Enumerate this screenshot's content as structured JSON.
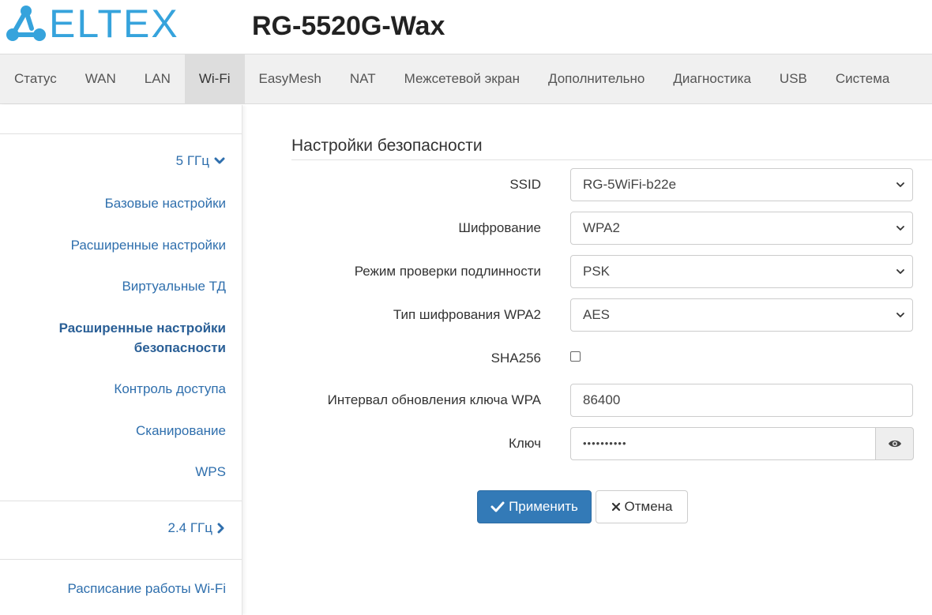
{
  "header": {
    "logo_text": "ELTEX",
    "model": "RG-5520G-Wax"
  },
  "nav": {
    "items": [
      {
        "label": "Статус",
        "active": false
      },
      {
        "label": "WAN",
        "active": false
      },
      {
        "label": "LAN",
        "active": false
      },
      {
        "label": "Wi-Fi",
        "active": true
      },
      {
        "label": "EasyMesh",
        "active": false
      },
      {
        "label": "NAT",
        "active": false
      },
      {
        "label": "Межсетевой экран",
        "active": false
      },
      {
        "label": "Дополнительно",
        "active": false
      },
      {
        "label": "Диагностика",
        "active": false
      },
      {
        "label": "USB",
        "active": false
      },
      {
        "label": "Система",
        "active": false
      }
    ]
  },
  "sidebar": {
    "group_5ghz": {
      "label": "5 ГГц",
      "icon": "chevron-down-icon",
      "expanded": true
    },
    "links": [
      {
        "label": "Базовые настройки",
        "active": false
      },
      {
        "label": "Расширенные настройки",
        "active": false
      },
      {
        "label": "Виртуальные ТД",
        "active": false
      },
      {
        "label_line1": "Расширенные настройки",
        "label_line2": "безопасности",
        "active": true
      },
      {
        "label": "Контроль доступа",
        "active": false
      },
      {
        "label": "Сканирование",
        "active": false
      },
      {
        "label": "WPS",
        "active": false
      }
    ],
    "group_24ghz": {
      "label": "2.4 ГГц",
      "icon": "chevron-right-icon",
      "expanded": false
    },
    "schedule_link": {
      "label": "Расписание работы Wi-Fi"
    }
  },
  "form": {
    "title": "Настройки безопасности",
    "ssid": {
      "label": "SSID",
      "value": "RG-5WiFi-b22e"
    },
    "encryption": {
      "label": "Шифрование",
      "value": "WPA2"
    },
    "auth_mode": {
      "label": "Режим проверки подлинности",
      "value": "PSK"
    },
    "wpa2_cipher": {
      "label": "Тип шифрования WPA2",
      "value": "AES"
    },
    "sha256": {
      "label": "SHA256",
      "checked": false
    },
    "rekey_interval": {
      "label": "Интервал обновления ключа WPA",
      "value": "86400"
    },
    "key": {
      "label": "Ключ",
      "value": "••••••••••",
      "toggle_icon": "eye-icon"
    },
    "apply_label": "Применить",
    "cancel_label": "Отмена"
  },
  "colors": {
    "brand": "#36a3dc",
    "link": "#2f6fad",
    "primary_button": "#337ab7",
    "nav_bg": "#f0f0f0",
    "nav_active_bg": "#dddddd"
  }
}
